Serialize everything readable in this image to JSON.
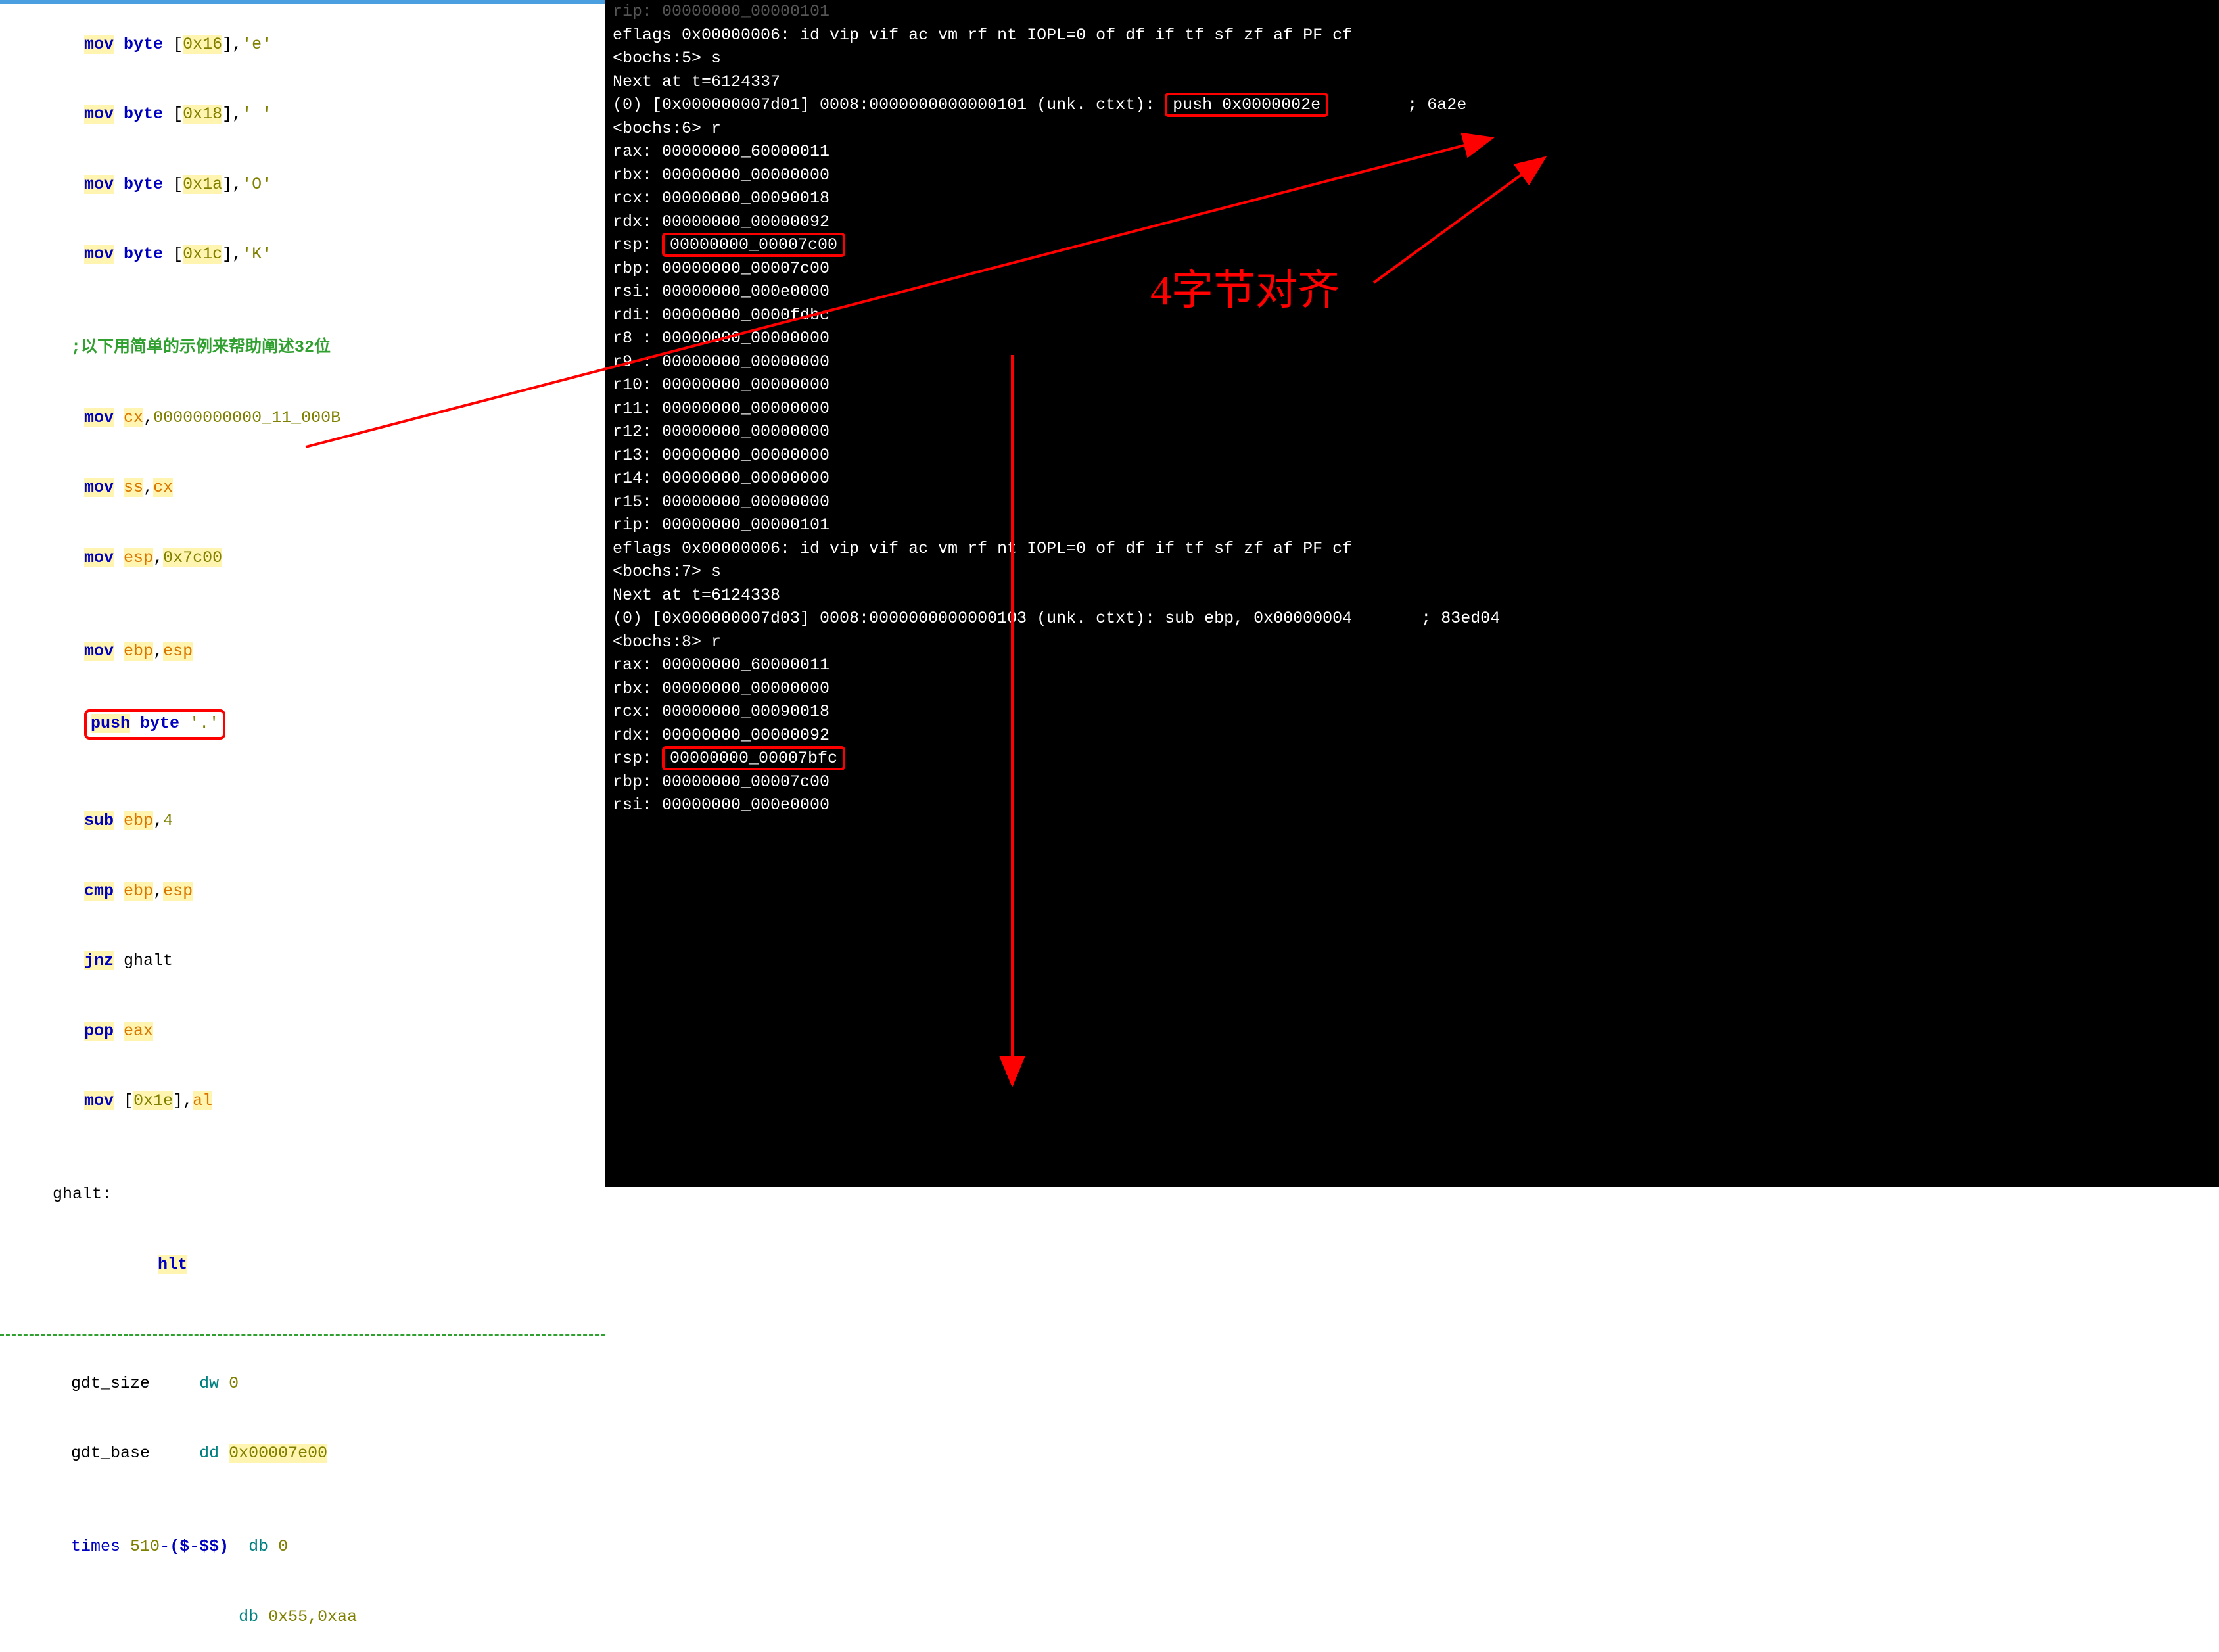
{
  "code": {
    "l1": {
      "op": "mov",
      "type": "byte",
      "addr": "0x16",
      "val": "'e'"
    },
    "l2": {
      "op": "mov",
      "type": "byte",
      "addr": "0x18",
      "val": "' '"
    },
    "l3": {
      "op": "mov",
      "type": "byte",
      "addr": "0x1a",
      "val": "'O'"
    },
    "l4": {
      "op": "mov",
      "type": "byte",
      "addr": "0x1c",
      "val": "'K'"
    },
    "comment1": ";以下用简单的示例来帮助阐述32位",
    "l5": {
      "op": "mov",
      "dst": "cx",
      "src": "00000000000_11_000B"
    },
    "l6": {
      "op": "mov",
      "dst": "ss",
      "src": "cx"
    },
    "l7": {
      "op": "mov",
      "dst": "esp",
      "src": "0x7c00"
    },
    "l8": {
      "op": "mov",
      "dst": "ebp",
      "src": "esp"
    },
    "l9": {
      "op": "push",
      "type": "byte",
      "val": "'.'"
    },
    "l10": {
      "op": "sub",
      "dst": "ebp",
      "src": "4"
    },
    "l11": {
      "op": "cmp",
      "dst": "ebp",
      "src": "esp"
    },
    "l12": {
      "op": "jnz",
      "tgt": "ghalt"
    },
    "l13": {
      "op": "pop",
      "dst": "eax"
    },
    "l14": {
      "op": "mov",
      "addr": "0x1e",
      "src": "al"
    },
    "label_ghalt": "ghalt:",
    "l15": {
      "op": "hlt"
    },
    "gdt_size_lbl": "gdt_size",
    "gdt_size_dir": "dw",
    "gdt_size_val": "0",
    "gdt_base_lbl": "gdt_base",
    "gdt_base_dir": "dd",
    "gdt_base_val": "0x00007e00",
    "times_kw": "times",
    "times_expr_510": "510",
    "times_minus": "-",
    "times_par": "($-$$)",
    "times_db": "db",
    "times_val": "0",
    "sig_db": "db",
    "sig_vals": "0x55,0xaa"
  },
  "term": {
    "t0": "rip: 00000000_00000101",
    "t1": "eflags 0x00000006: id vip vif ac vm rf nt IOPL=0 of df if tf sf zf af PF cf",
    "t2a": "<bochs:5>",
    "t2b": " s",
    "t3": "Next at t=6124337",
    "t4a": "(0) [0x000000007d01] 0008:0000000000000101 (unk. ctxt): ",
    "t4b": "push 0x0000002e",
    "t4c": "        ; 6a2e",
    "t5a": "<bochs:6>",
    "t5b": " r",
    "regs1": {
      "rax": "rax: 00000000_60000011",
      "rbx": "rbx: 00000000_00000000",
      "rcx": "rcx: 00000000_00090018",
      "rdx": "rdx: 00000000_00000092",
      "rsp_lbl": "rsp: ",
      "rsp_val": "00000000_00007c00",
      "rbp": "rbp: 00000000_00007c00",
      "rsi": "rsi: 00000000_000e0000",
      "rdi": "rdi: 00000000_0000fdbc",
      "r8": "r8 : 00000000_00000000",
      "r9": "r9 : 00000000_00000000",
      "r10": "r10: 00000000_00000000",
      "r11": "r11: 00000000_00000000",
      "r12": "r12: 00000000_00000000",
      "r13": "r13: 00000000_00000000",
      "r14": "r14: 00000000_00000000",
      "r15": "r15: 00000000_00000000",
      "rip": "rip: 00000000_00000101"
    },
    "t20": "eflags 0x00000006: id vip vif ac vm rf nt IOPL=0 of df if tf sf zf af PF cf",
    "t21a": "<bochs:7>",
    "t21b": " s",
    "t22": "Next at t=6124338",
    "t23": "(0) [0x000000007d03] 0008:0000000000000103 (unk. ctxt): sub ebp, 0x00000004       ; 83ed04",
    "t24a": "<bochs:8>",
    "t24b": " r",
    "regs2": {
      "rax": "rax: 00000000_60000011",
      "rbx": "rbx: 00000000_00000000",
      "rcx": "rcx: 00000000_00090018",
      "rdx": "rdx: 00000000_00000092",
      "rsp_lbl": "rsp: ",
      "rsp_val": "00000000_00007bfc",
      "rbp": "rbp: 00000000_00007c00",
      "rsi": "rsi: 00000000_000e0000"
    }
  },
  "annotation": "4字节对齐"
}
